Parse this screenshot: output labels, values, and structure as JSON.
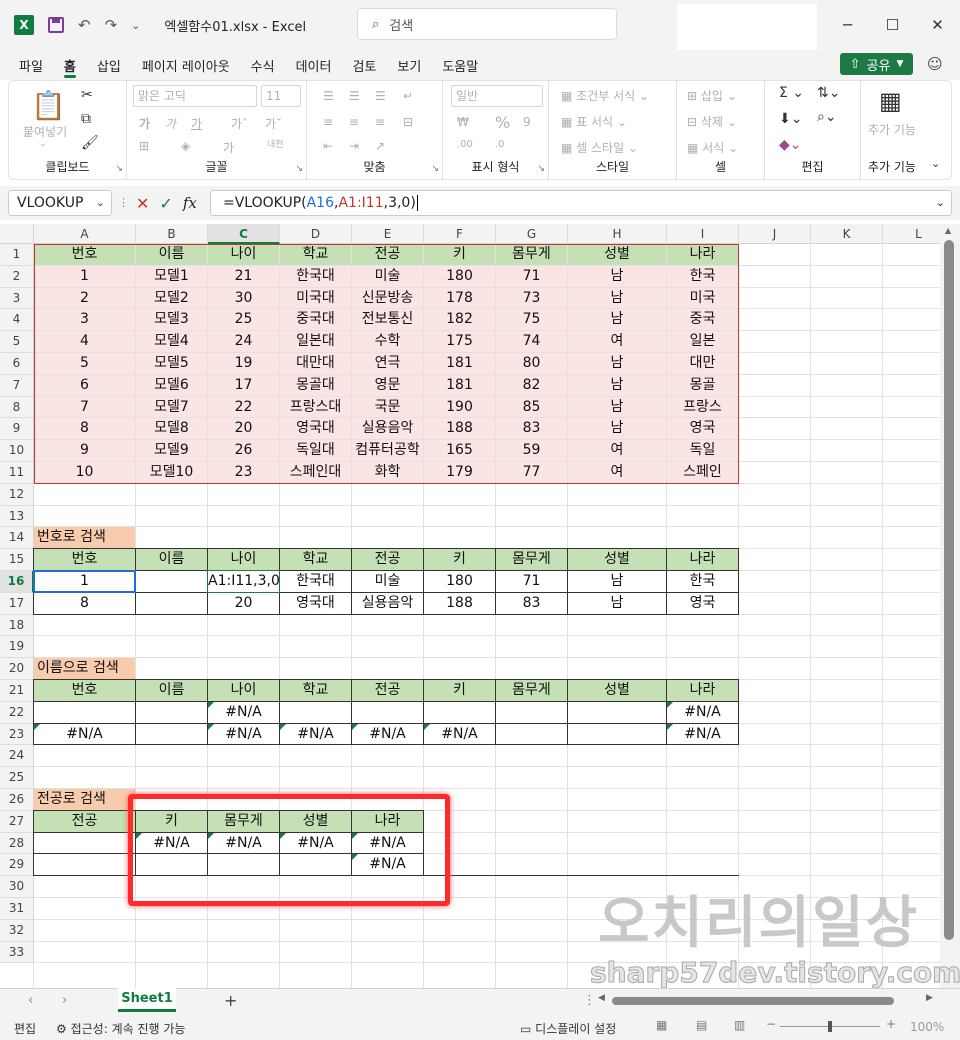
{
  "window": {
    "filename": "엑셀함수01.xlsx",
    "app": "Excel",
    "search_placeholder": "검색"
  },
  "menu": {
    "tabs": [
      "파일",
      "홈",
      "삽입",
      "페이지 레이아웃",
      "수식",
      "데이터",
      "검토",
      "보기",
      "도움말"
    ],
    "active": "홈",
    "share_label": "공유"
  },
  "ribbon": {
    "clipboard": {
      "label": "클립보드",
      "paste": "붙여넣기"
    },
    "font": {
      "label": "글꼴",
      "font_name": "맑은 고딕",
      "font_size": "11",
      "bold": "가",
      "italic": "가",
      "underline": "가"
    },
    "alignment": {
      "label": "맞춤"
    },
    "number": {
      "label": "표시 형식",
      "format": "일반"
    },
    "styles": {
      "label": "스타일",
      "conditional": "조건부 서식",
      "table": "표 서식",
      "cell_styles": "셀 스타일"
    },
    "cells": {
      "label": "셀",
      "insert": "삽입",
      "delete": "삭제",
      "format": "서식"
    },
    "editing": {
      "label": "편집"
    },
    "addins": {
      "label": "추가 기능",
      "btn": "추가 기능"
    }
  },
  "formula_bar": {
    "namebox": "VLOOKUP",
    "formula_prefix": "=VLOOKUP(",
    "formula_ref1": "A16",
    "formula_sep1": ",",
    "formula_ref2": "A1:I11",
    "formula_suffix": ",3,0)"
  },
  "columns": [
    "A",
    "B",
    "C",
    "D",
    "E",
    "F",
    "G",
    "H",
    "I",
    "J",
    "K",
    "L"
  ],
  "rows": [
    "1",
    "2",
    "3",
    "4",
    "5",
    "6",
    "7",
    "8",
    "9",
    "10",
    "11",
    "12",
    "13",
    "14",
    "15",
    "16",
    "17",
    "18",
    "19",
    "20",
    "21",
    "22",
    "23",
    "24",
    "25",
    "26",
    "27",
    "28",
    "29",
    "30",
    "31",
    "32",
    "33"
  ],
  "table1": {
    "headers": [
      "번호",
      "이름",
      "나이",
      "학교",
      "전공",
      "키",
      "몸무게",
      "성별",
      "나라"
    ],
    "rows": [
      [
        "1",
        "모델1",
        "21",
        "한국대",
        "미술",
        "180",
        "71",
        "남",
        "한국"
      ],
      [
        "2",
        "모델2",
        "30",
        "미국대",
        "신문방송",
        "178",
        "73",
        "남",
        "미국"
      ],
      [
        "3",
        "모델3",
        "25",
        "중국대",
        "전보통신",
        "182",
        "75",
        "남",
        "중국"
      ],
      [
        "4",
        "모델4",
        "24",
        "일본대",
        "수학",
        "175",
        "74",
        "여",
        "일본"
      ],
      [
        "5",
        "모델5",
        "19",
        "대만대",
        "연극",
        "181",
        "80",
        "남",
        "대만"
      ],
      [
        "6",
        "모델6",
        "17",
        "몽골대",
        "영문",
        "181",
        "82",
        "남",
        "몽골"
      ],
      [
        "7",
        "모델7",
        "22",
        "프랑스대",
        "국문",
        "190",
        "85",
        "남",
        "프랑스"
      ],
      [
        "8",
        "모델8",
        "20",
        "영국대",
        "실용음악",
        "188",
        "83",
        "남",
        "영국"
      ],
      [
        "9",
        "모델9",
        "26",
        "독일대",
        "컴퓨터공학",
        "165",
        "59",
        "여",
        "독일"
      ],
      [
        "10",
        "모델10",
        "23",
        "스페인대",
        "화학",
        "179",
        "77",
        "여",
        "스페인"
      ]
    ]
  },
  "section2": {
    "title": "번호로 검색",
    "headers": [
      "번호",
      "이름",
      "나이",
      "학교",
      "전공",
      "키",
      "몸무게",
      "성별",
      "나라"
    ],
    "rows": [
      [
        "1",
        "",
        "A1:I11,3,0)",
        "한국대",
        "미술",
        "180",
        "71",
        "남",
        "한국"
      ],
      [
        "8",
        "",
        "20",
        "영국대",
        "실용음악",
        "188",
        "83",
        "남",
        "영국"
      ]
    ]
  },
  "section3": {
    "title": "이름으로 검색",
    "headers": [
      "번호",
      "이름",
      "나이",
      "학교",
      "전공",
      "키",
      "몸무게",
      "성별",
      "나라"
    ],
    "rows": [
      [
        "",
        "",
        "#N/A",
        "",
        "",
        "",
        "",
        "",
        "#N/A"
      ],
      [
        "#N/A",
        "",
        "#N/A",
        "#N/A",
        "#N/A",
        "#N/A",
        "",
        "",
        "#N/A"
      ]
    ]
  },
  "section4": {
    "title": "전공로 검색",
    "headers": [
      "전공",
      "키",
      "몸무게",
      "성별",
      "나라"
    ],
    "rows": [
      [
        "",
        "#N/A",
        "#N/A",
        "#N/A",
        "#N/A"
      ],
      [
        "",
        "",
        "",
        "",
        "#N/A"
      ]
    ]
  },
  "sheet_tab": "Sheet1",
  "status": {
    "mode": "편집",
    "accessibility": "접근성: 계속 진행 가능",
    "display_settings": "디스플레이 설정",
    "zoom": "100%"
  },
  "watermark": {
    "line1": "오치리의일상",
    "line2": "sharp57dev.tistory.com"
  },
  "colors": {
    "excel_green": "#107c41",
    "header_fill": "#c5e0b4",
    "table_fill": "#fbe4e4",
    "section_title_fill": "#f8cbad",
    "highlight_box": "#ff2a2a"
  }
}
